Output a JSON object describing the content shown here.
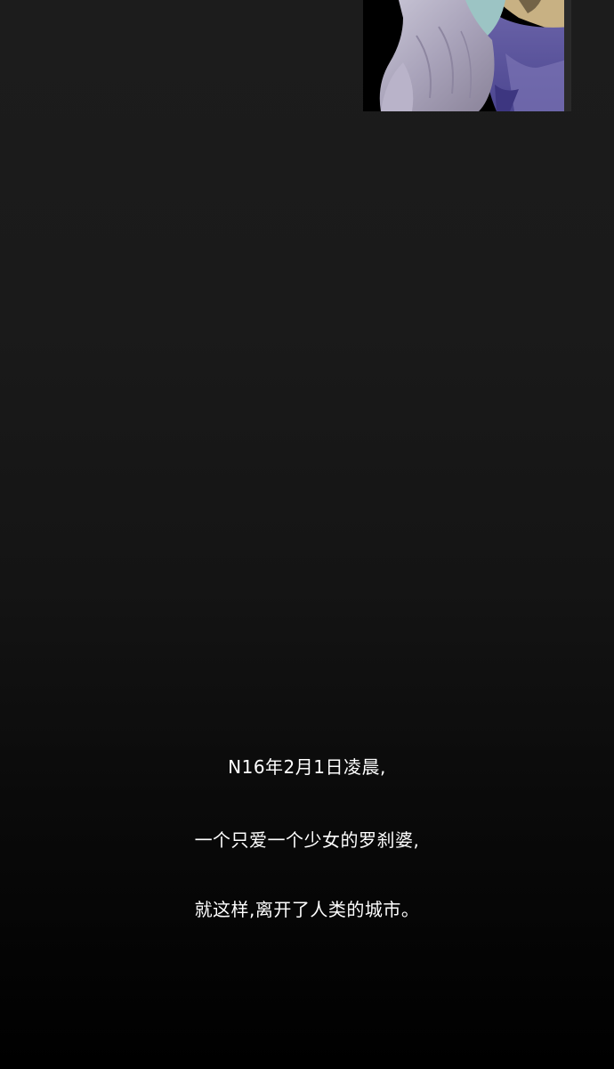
{
  "comic_panel": {
    "icon": "character-hair-scarf-illustration"
  },
  "narration": {
    "line1": "N16年2月1日凌晨,",
    "line2": "一个只爱一个少女的罗刹婆,",
    "line3": "就这样,离开了人类的城市。"
  }
}
